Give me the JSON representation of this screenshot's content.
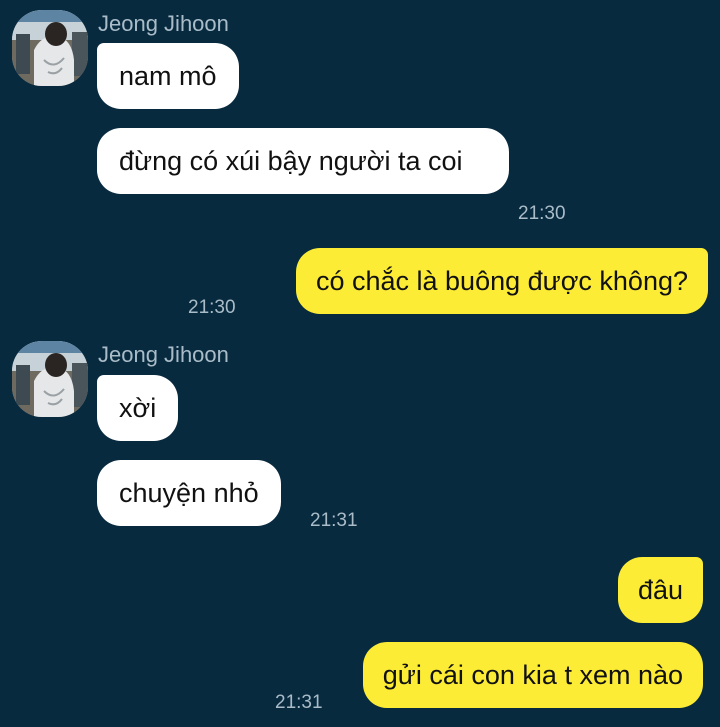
{
  "groups": [
    {
      "sender": "Jeong Jihoon",
      "messages": [
        {
          "text": "nam mô"
        },
        {
          "text": "đừng có xúi bậy người ta coi",
          "time": "21:30"
        }
      ]
    },
    {
      "outgoing": true,
      "messages": [
        {
          "text": "có chắc là buông được không?",
          "time": "21:30"
        }
      ]
    },
    {
      "sender": "Jeong Jihoon",
      "messages": [
        {
          "text": "xời"
        },
        {
          "text": "chuyện nhỏ",
          "time": "21:31"
        }
      ]
    },
    {
      "outgoing": true,
      "messages": [
        {
          "text": "đâu"
        },
        {
          "text": "gửi cái con kia t xem nào",
          "time": "21:31"
        }
      ]
    }
  ],
  "colors": {
    "background": "#082a3f",
    "incoming_bubble": "#ffffff",
    "outgoing_bubble": "#fcec36",
    "meta_text": "#a9bcc8"
  },
  "icons": {
    "avatar": "profile-photo-avatar-icon"
  }
}
